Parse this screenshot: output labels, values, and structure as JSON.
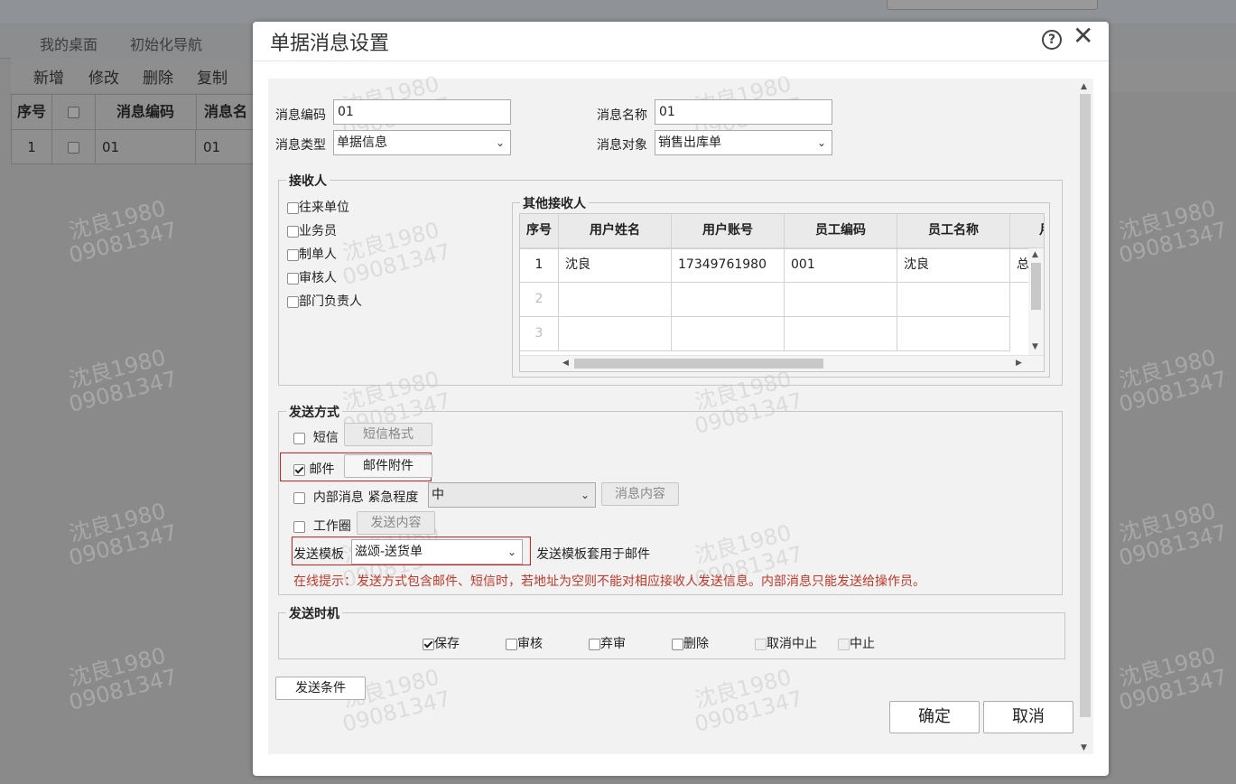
{
  "background": {
    "nav_tabs": [
      "我的桌面",
      "初始化导航"
    ],
    "toolbar": [
      "新增",
      "修改",
      "删除",
      "复制"
    ],
    "table": {
      "headers": [
        "序号",
        "",
        "消息编码",
        "消息名"
      ],
      "row": [
        "1",
        "",
        "01",
        "01"
      ]
    }
  },
  "watermark": {
    "line1": "沈良1980",
    "line2": "09081347"
  },
  "dialog": {
    "title": "单据消息设置",
    "help_icon": "?",
    "close_icon": "✕",
    "fields": {
      "code_label": "消息编码",
      "code_value": "01",
      "name_label": "消息名称",
      "name_value": "01",
      "type_label": "消息类型",
      "type_value": "单据信息",
      "object_label": "消息对象",
      "object_value": "销售出库单"
    },
    "receivers": {
      "legend": "接收人",
      "options": [
        {
          "label": "往来单位",
          "checked": false
        },
        {
          "label": "业务员",
          "checked": false
        },
        {
          "label": "制单人",
          "checked": false
        },
        {
          "label": "审核人",
          "checked": false
        },
        {
          "label": "部门负责人",
          "checked": false
        }
      ],
      "other_legend": "其他接收人",
      "columns": [
        "序号",
        "用户姓名",
        "用户账号",
        "员工编码",
        "员工名称",
        "月"
      ],
      "rows": [
        {
          "no": "1",
          "name": "沈良",
          "account": "17349761980",
          "emp_code": "001",
          "emp_name": "沈良",
          "extra": "总"
        },
        {
          "no": "2",
          "name": "",
          "account": "",
          "emp_code": "",
          "emp_name": "",
          "extra": ""
        },
        {
          "no": "3",
          "name": "",
          "account": "",
          "emp_code": "",
          "emp_name": "",
          "extra": ""
        }
      ]
    },
    "send_method": {
      "legend": "发送方式",
      "sms_label": "短信",
      "sms_button": "短信格式",
      "email_label": "邮件",
      "email_checked": true,
      "email_button": "邮件附件",
      "internal_label": "内部消息",
      "urgency_label": "紧急程度",
      "urgency_value": "中",
      "internal_button": "消息内容",
      "circle_label": "工作圈",
      "circle_button": "发送内容",
      "template_label": "发送模板",
      "template_value": "滋颂-送货单",
      "template_note": "发送模板套用于邮件",
      "tip": "在线提示：发送方式包含邮件、短信时，若地址为空则不能对相应接收人发送信息。内部消息只能发送给操作员。"
    },
    "send_timing": {
      "legend": "发送时机",
      "options": [
        {
          "label": "保存",
          "checked": true,
          "disabled": false
        },
        {
          "label": "审核",
          "checked": false,
          "disabled": false
        },
        {
          "label": "弃审",
          "checked": false,
          "disabled": false
        },
        {
          "label": "删除",
          "checked": false,
          "disabled": false
        },
        {
          "label": "取消中止",
          "checked": false,
          "disabled": true
        },
        {
          "label": "中止",
          "checked": false,
          "disabled": true
        }
      ]
    },
    "condition_button": "发送条件",
    "ok_button": "确定",
    "cancel_button": "取消"
  }
}
